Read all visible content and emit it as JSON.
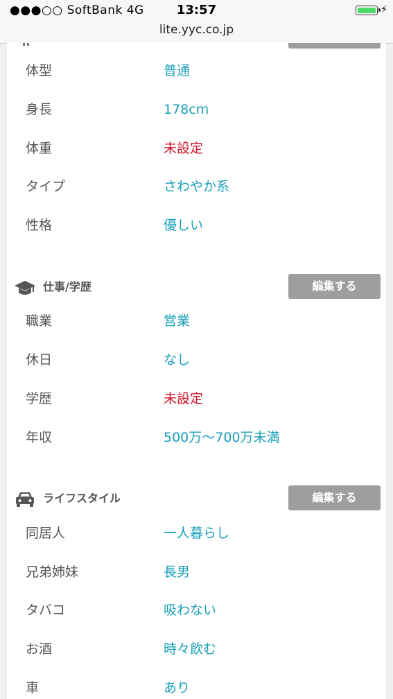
{
  "status_bar": {
    "carrier": "●●●○○ SoftBank   4G",
    "time": "13:57",
    "battery_color": "#4cd964"
  },
  "browser": {
    "url": "lite.yyc.co.jp"
  },
  "colors": {
    "value": "#199fb9",
    "unset": "#d0142a",
    "button": "#9e9e9e"
  },
  "appearance_rows": [
    {
      "label": "体型",
      "value": "普通",
      "unset": false
    },
    {
      "label": "身長",
      "value": "178cm",
      "unset": false
    },
    {
      "label": "体重",
      "value": "未設定",
      "unset": true
    },
    {
      "label": "タイプ",
      "value": "さわやか系",
      "unset": false
    },
    {
      "label": "性格",
      "value": "優しい",
      "unset": false
    }
  ],
  "work_section": {
    "title": "仕事/学歴",
    "icon": "graduation-cap-icon",
    "edit_label": "編集する",
    "rows": [
      {
        "label": "職業",
        "value": "営業",
        "unset": false
      },
      {
        "label": "休日",
        "value": "なし",
        "unset": false
      },
      {
        "label": "学歴",
        "value": "未設定",
        "unset": true
      },
      {
        "label": "年収",
        "value": "500万〜700万未満",
        "unset": false
      }
    ]
  },
  "lifestyle_section": {
    "title": "ライフスタイル",
    "icon": "car-icon",
    "edit_label": "編集する",
    "rows": [
      {
        "label": "同居人",
        "value": "一人暮らし",
        "unset": false
      },
      {
        "label": "兄弟姉妹",
        "value": "長男",
        "unset": false
      },
      {
        "label": "タバコ",
        "value": "吸わない",
        "unset": false
      },
      {
        "label": "お酒",
        "value": "時々飲む",
        "unset": false
      },
      {
        "label": "車",
        "value": "あり",
        "unset": false
      }
    ]
  }
}
